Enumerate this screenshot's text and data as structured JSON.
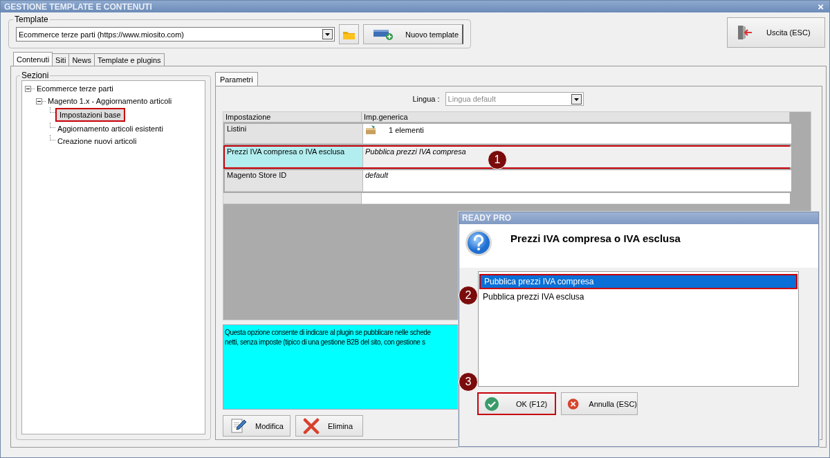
{
  "window": {
    "title": "GESTIONE TEMPLATE E CONTENUTI",
    "close": "×"
  },
  "template_group": {
    "label": "Template",
    "value": "Ecommerce terze parti (https://www.miosito.com)",
    "new_button": "Nuovo template"
  },
  "exit_button": "Uscita (ESC)",
  "tabs": [
    {
      "label": "Contenuti",
      "selected": true
    },
    {
      "label": "Siti",
      "selected": false
    },
    {
      "label": "News",
      "selected": false
    },
    {
      "label": "Template e plugins",
      "selected": false
    }
  ],
  "sections": {
    "label": "Sezioni",
    "tree": [
      {
        "label": "Ecommerce terze parti",
        "expanded": true,
        "selected": false,
        "highlighted": false,
        "children": [
          {
            "label": "Magento 1.x - Aggiornamento articoli",
            "expanded": true,
            "selected": false,
            "highlighted": false,
            "children": [
              {
                "label": "Impostazioni base",
                "selected": true,
                "highlighted": true
              },
              {
                "label": "Aggiornamento articoli esistenti",
                "selected": false,
                "highlighted": false
              },
              {
                "label": "Creazione nuovi articoli",
                "selected": false,
                "highlighted": false
              }
            ]
          }
        ]
      }
    ]
  },
  "params_tabs": [
    {
      "label": "Parametri",
      "selected": true
    }
  ],
  "language": {
    "label": "Lingua :",
    "value": "Lingua default",
    "disabled": true
  },
  "grid": {
    "columns": [
      "Impostazione",
      "Imp.generica"
    ],
    "rows": [
      {
        "name": "Listini",
        "value": "1 elementi",
        "kind": "list",
        "selected": false,
        "highlighted": false
      },
      {
        "name": "Prezzi IVA compresa o IVA esclusa",
        "value": "Pubblica prezzi IVA compresa",
        "kind": "text",
        "selected": true,
        "highlighted": true
      },
      {
        "name": "Magento Store ID",
        "value": "default",
        "kind": "text",
        "selected": false,
        "highlighted": false
      }
    ]
  },
  "description": "Questa opzione consente di indicare al plugin se pubblicare nelle schede\nnetti, senza imposte (tipico di una gestione B2B del sito, con gestione s",
  "actions": [
    {
      "label": "Modifica",
      "kind": "edit"
    },
    {
      "label": "Elimina",
      "kind": "delete"
    }
  ],
  "dialog": {
    "title": "READY PRO",
    "question": "Prezzi IVA compresa o IVA esclusa",
    "options": [
      {
        "label": "Pubblica prezzi IVA compresa",
        "selected": true,
        "highlighted": true
      },
      {
        "label": "Pubblica prezzi IVA esclusa",
        "selected": false,
        "highlighted": false
      }
    ],
    "buttons": [
      {
        "label": "OK (F12)",
        "kind": "ok",
        "highlighted": true
      },
      {
        "label": "Annulla (ESC)",
        "kind": "cancel",
        "highlighted": false
      }
    ]
  },
  "annotations": [
    {
      "label": "1"
    },
    {
      "label": "2"
    },
    {
      "label": "3"
    }
  ]
}
